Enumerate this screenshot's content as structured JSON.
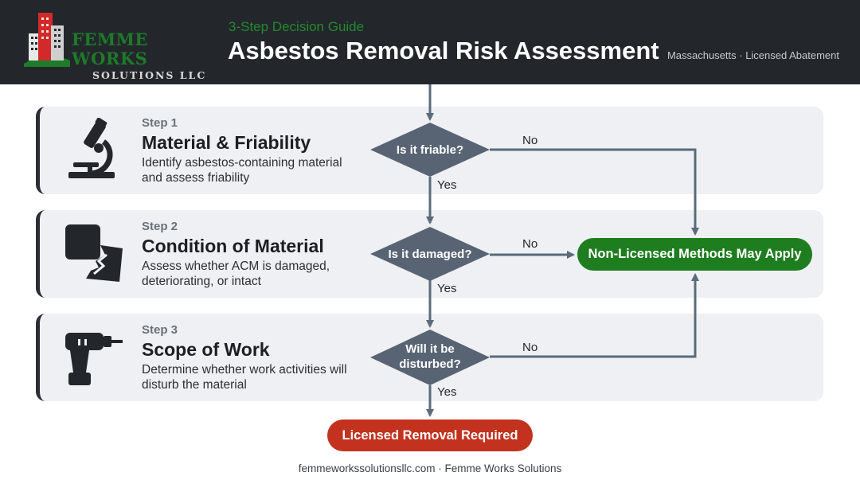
{
  "brand": {
    "name": "FEMME WORKS",
    "subtitle": "SOLUTIONS LLC",
    "colors": {
      "green": "#1e7a28",
      "dark": "#23272c"
    }
  },
  "header": {
    "eyebrow": "3-Step Decision Guide",
    "title": "Asbestos Removal Risk Assessment",
    "meta": "Massachusetts · Licensed Abatement"
  },
  "steps": [
    {
      "label": "Step 1",
      "title": "Material & Friability",
      "description": "Identify asbestos-containing material and assess friability",
      "icon": "microscope-icon",
      "question": "Is it friable?",
      "yes_label": "Yes",
      "no_label": "No"
    },
    {
      "label": "Step 2",
      "title": "Condition of Material",
      "description": "Assess whether ACM is damaged, deteriorating, or intact",
      "icon": "broken-tile-icon",
      "question": "Is it damaged?",
      "yes_label": "Yes",
      "no_label": "No"
    },
    {
      "label": "Step 3",
      "title": "Scope of Work",
      "description": "Determine whether work activities will disturb the material",
      "icon": "drill-icon",
      "question": "Will it be disturbed?",
      "question_lines": [
        "Will it be",
        "disturbed?"
      ],
      "yes_label": "Yes",
      "no_label": "No"
    }
  ],
  "outcomes": {
    "non_licensed": {
      "label": "Non-Licensed Methods May Apply",
      "color": "#1e7d1f"
    },
    "licensed": {
      "label": "Licensed Removal Required",
      "color": "#c2321f"
    }
  },
  "footer": {
    "text": "femmeworkssolutionsllc.com · Femme Works Solutions"
  },
  "colors": {
    "connector": "#5a6b7b",
    "diamond": "#586473",
    "panel": "#eef0f3"
  }
}
